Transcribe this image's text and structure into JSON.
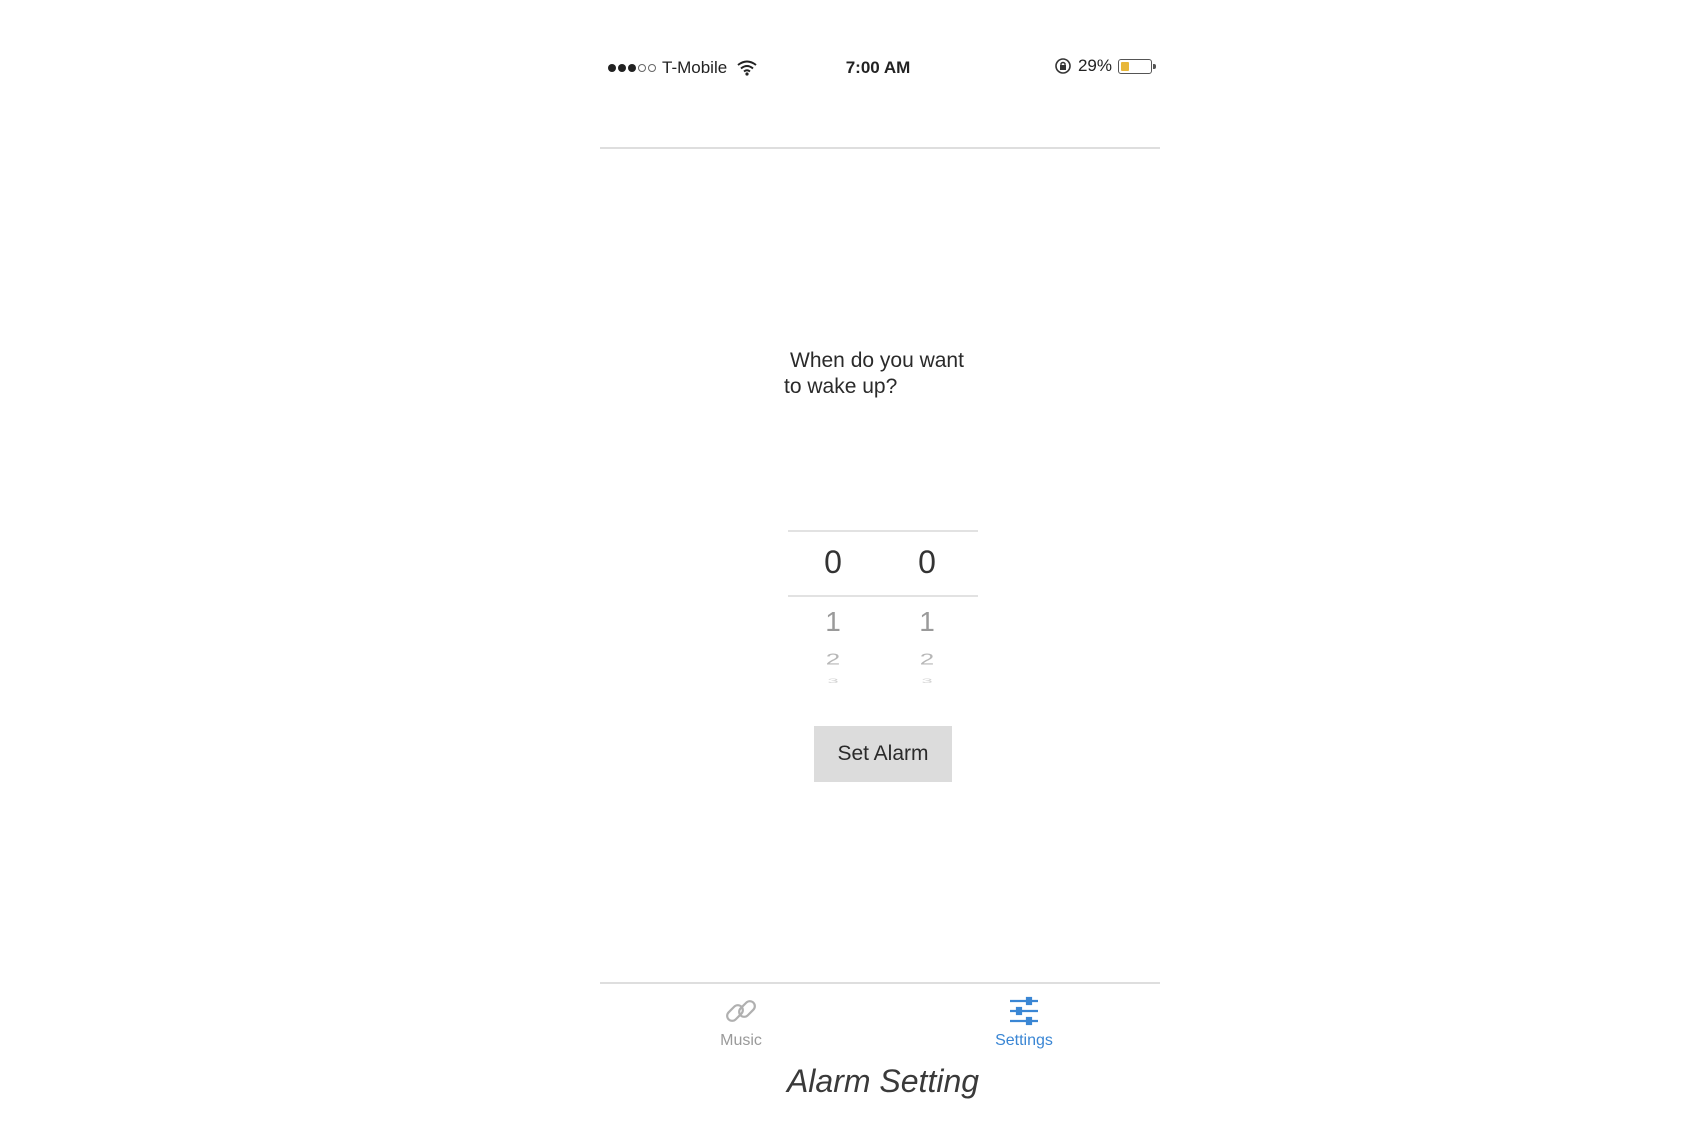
{
  "status_bar": {
    "signal_filled": 3,
    "signal_empty": 2,
    "carrier": "T-Mobile",
    "time": "7:00 AM",
    "battery_percent": "29%",
    "battery_level": 0.29,
    "battery_color": "#e8b73a"
  },
  "main": {
    "prompt_line1": "When do you want",
    "prompt_line2": "to wake up?",
    "picker": {
      "hours": {
        "selected": "0",
        "next": [
          "1",
          "2"
        ]
      },
      "minutes": {
        "selected": "0",
        "next": [
          "1",
          "2"
        ]
      }
    },
    "set_alarm_label": "Set Alarm"
  },
  "tab_bar": {
    "tabs": [
      {
        "label": "Music",
        "icon": "link-icon",
        "active": false
      },
      {
        "label": "Settings",
        "icon": "sliders-icon",
        "active": true
      }
    ],
    "active_color": "#3a86d4",
    "inactive_color": "#9a9a9a"
  },
  "caption": "Alarm Setting"
}
